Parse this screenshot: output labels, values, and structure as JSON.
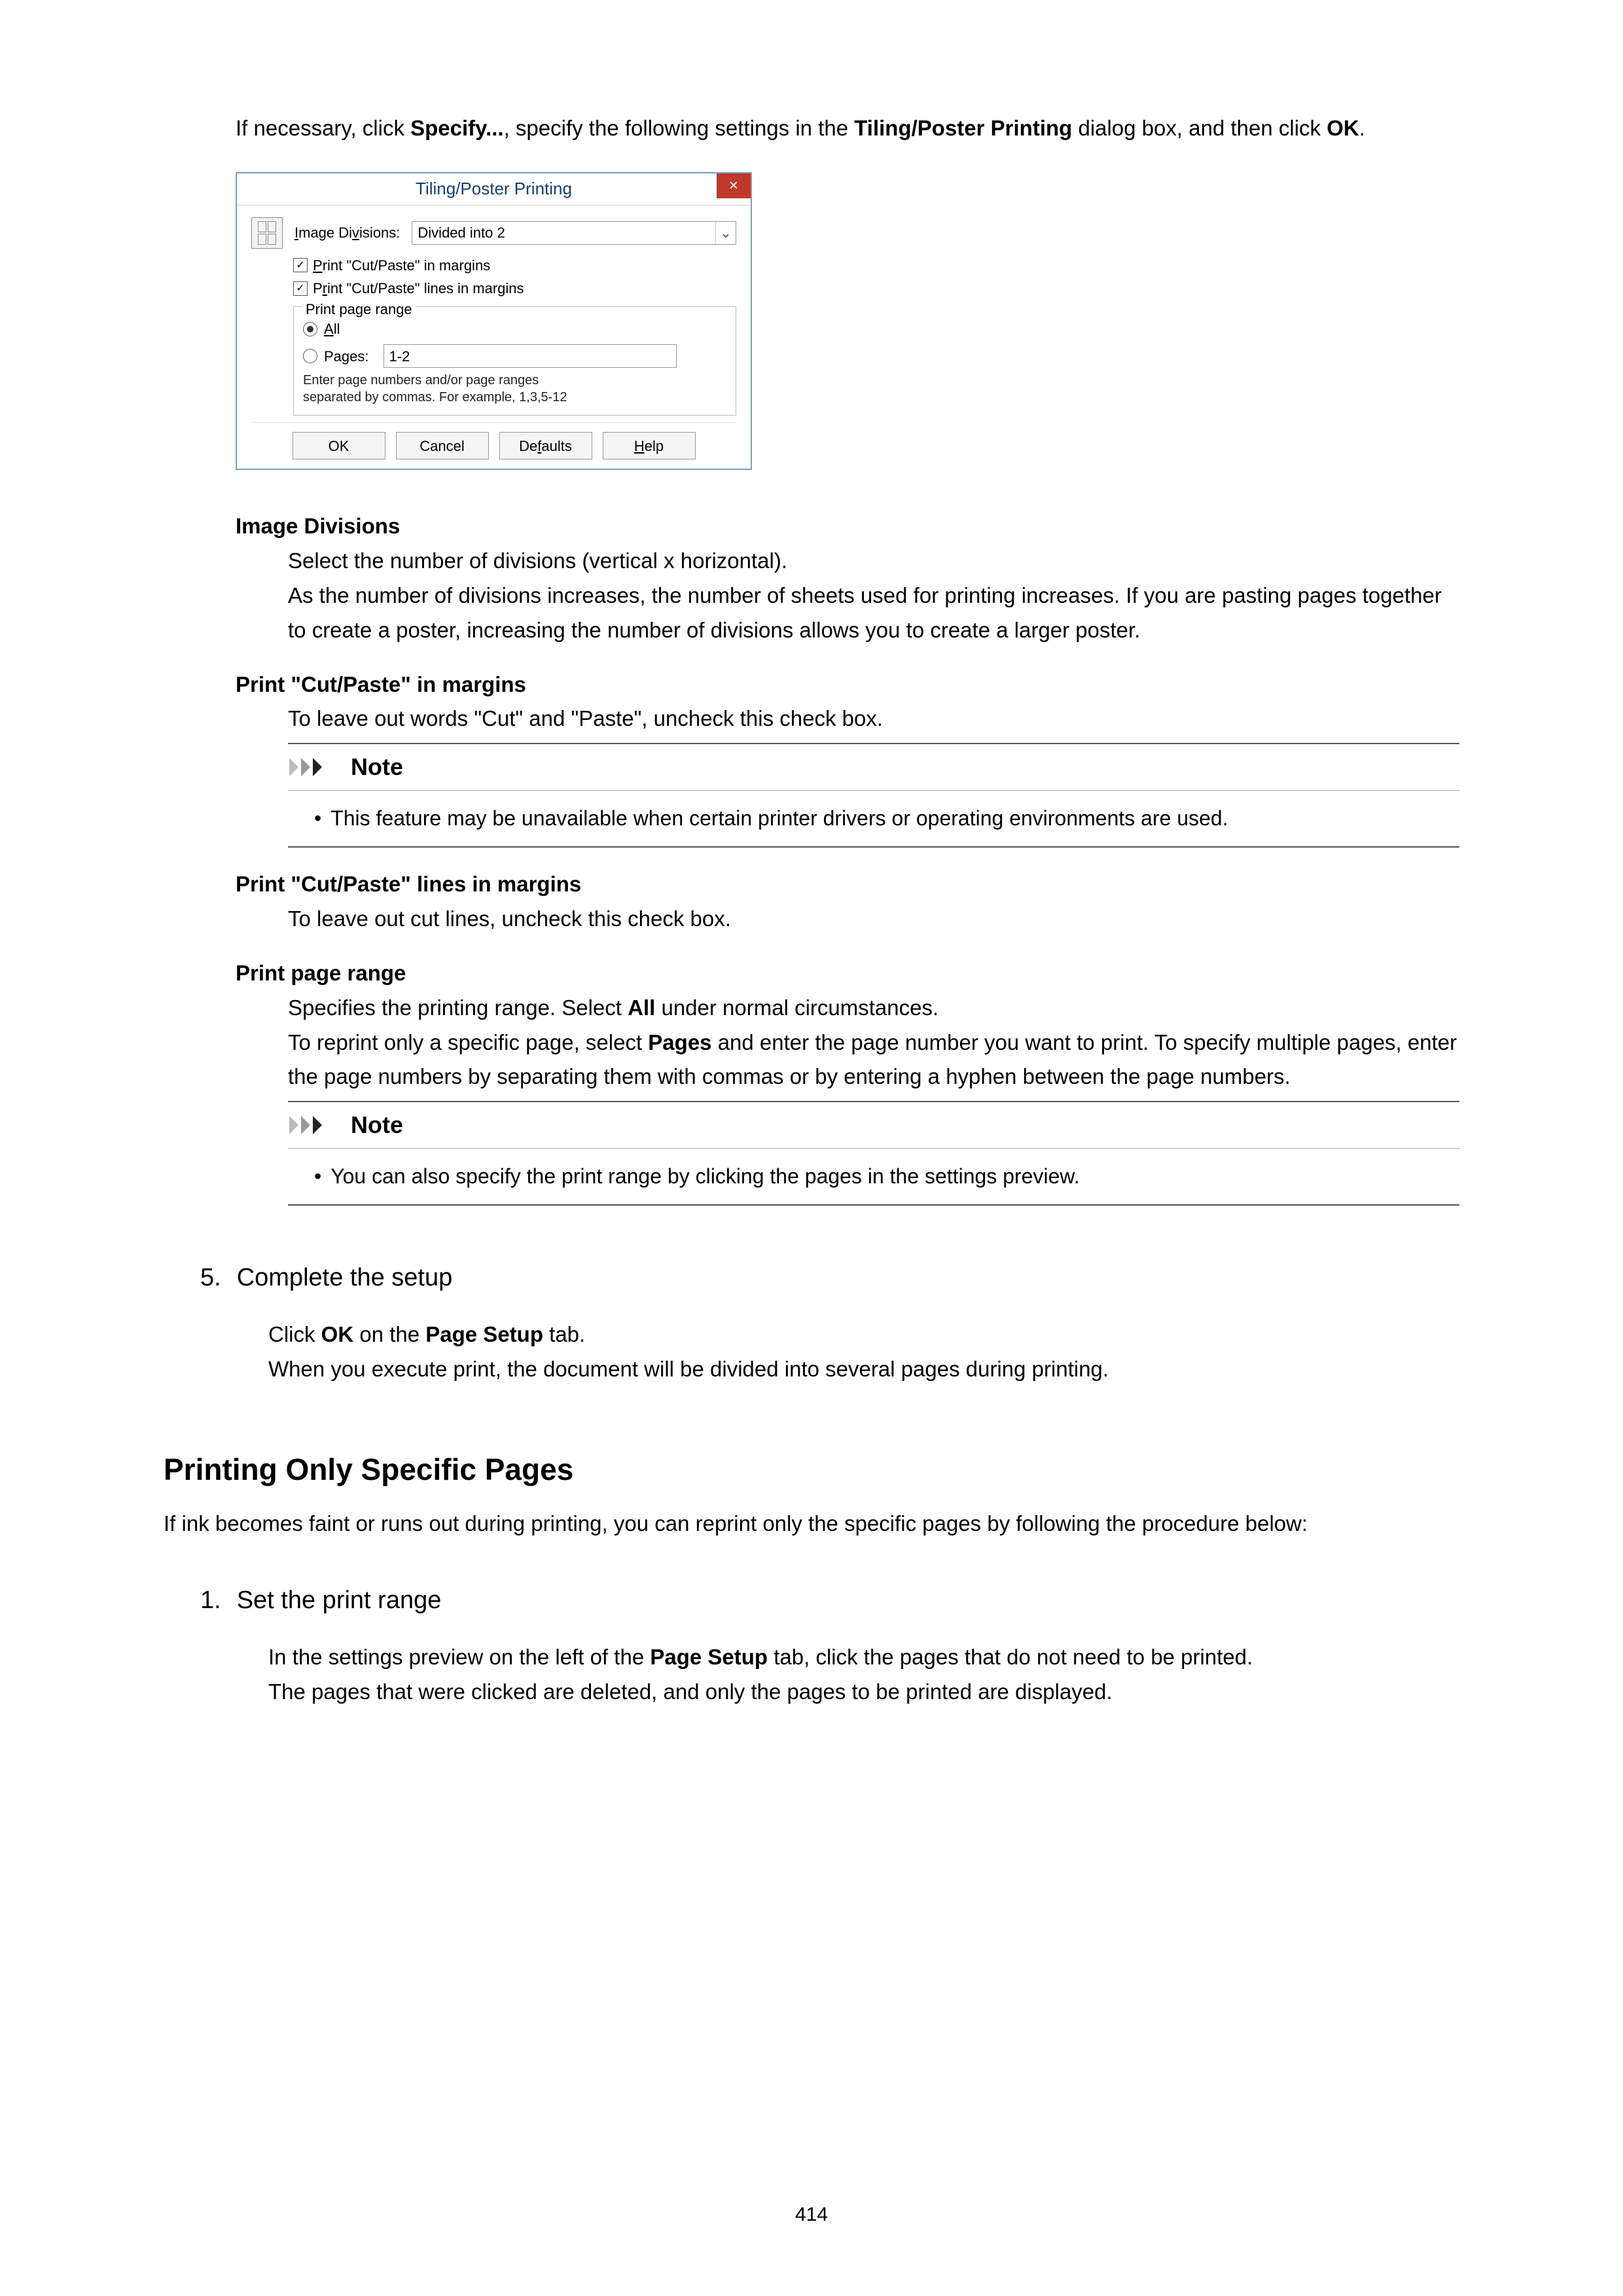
{
  "intro": {
    "pre": "If necessary, click ",
    "specify": "Specify...",
    "mid": ", specify the following settings in the ",
    "dialog_name": "Tiling/Poster Printing",
    "post1": " dialog box, and then click ",
    "ok": "OK",
    "end": "."
  },
  "dialog": {
    "title": "Tiling/Poster Printing",
    "close": "×",
    "image_divisions_label": "Image Divisions:",
    "image_divisions_value": "Divided into 2",
    "chk_margins": "Print \"Cut/Paste\" in margins",
    "chk_lines": "Print \"Cut/Paste\" lines in margins",
    "range_legend": "Print page range",
    "opt_all": "All",
    "opt_pages": "Pages:",
    "pages_value": "1-2",
    "hint1": "Enter page numbers and/or page ranges",
    "hint2": "separated by commas. For example, 1,3,5-12",
    "buttons": {
      "ok": "OK",
      "cancel": "Cancel",
      "defaults": "Defaults",
      "help": "Help"
    }
  },
  "defs": {
    "img_div_t": "Image Divisions",
    "img_div_d1": "Select the number of divisions (vertical x horizontal).",
    "img_div_d2": "As the number of divisions increases, the number of sheets used for printing increases. If you are pasting pages together to create a poster, increasing the number of divisions allows you to create a larger poster.",
    "margins_t": "Print \"Cut/Paste\" in margins",
    "margins_d": "To leave out words \"Cut\" and \"Paste\", uncheck this check box.",
    "note_label": "Note",
    "note1": "This feature may be unavailable when certain printer drivers or operating environments are used.",
    "lines_t": "Print \"Cut/Paste\" lines in margins",
    "lines_d": "To leave out cut lines, uncheck this check box.",
    "range_t": "Print page range",
    "range_d1a": "Specifies the printing range. Select ",
    "range_d1b": "All",
    "range_d1c": " under normal circumstances.",
    "range_d2a": "To reprint only a specific page, select ",
    "range_d2b": "Pages",
    "range_d2c": " and enter the page number you want to print. To specify multiple pages, enter the page numbers by separating them with commas or by entering a hyphen between the page numbers.",
    "note2": "You can also specify the print range by clicking the pages in the settings preview."
  },
  "step5": {
    "num": "5.",
    "title": "Complete the setup",
    "p1a": "Click ",
    "p1b": "OK",
    "p1c": " on the ",
    "p1d": "Page Setup",
    "p1e": " tab.",
    "p2": "When you execute print, the document will be divided into several pages during printing."
  },
  "section2": {
    "heading": "Printing Only Specific Pages",
    "intro": "If ink becomes faint or runs out during printing, you can reprint only the specific pages by following the procedure below:"
  },
  "step1": {
    "num": "1.",
    "title": "Set the print range",
    "p1a": "In the settings preview on the left of the ",
    "p1b": "Page Setup",
    "p1c": " tab, click the pages that do not need to be printed.",
    "p2": "The pages that were clicked are deleted, and only the pages to be printed are displayed."
  },
  "pagenum": "414"
}
